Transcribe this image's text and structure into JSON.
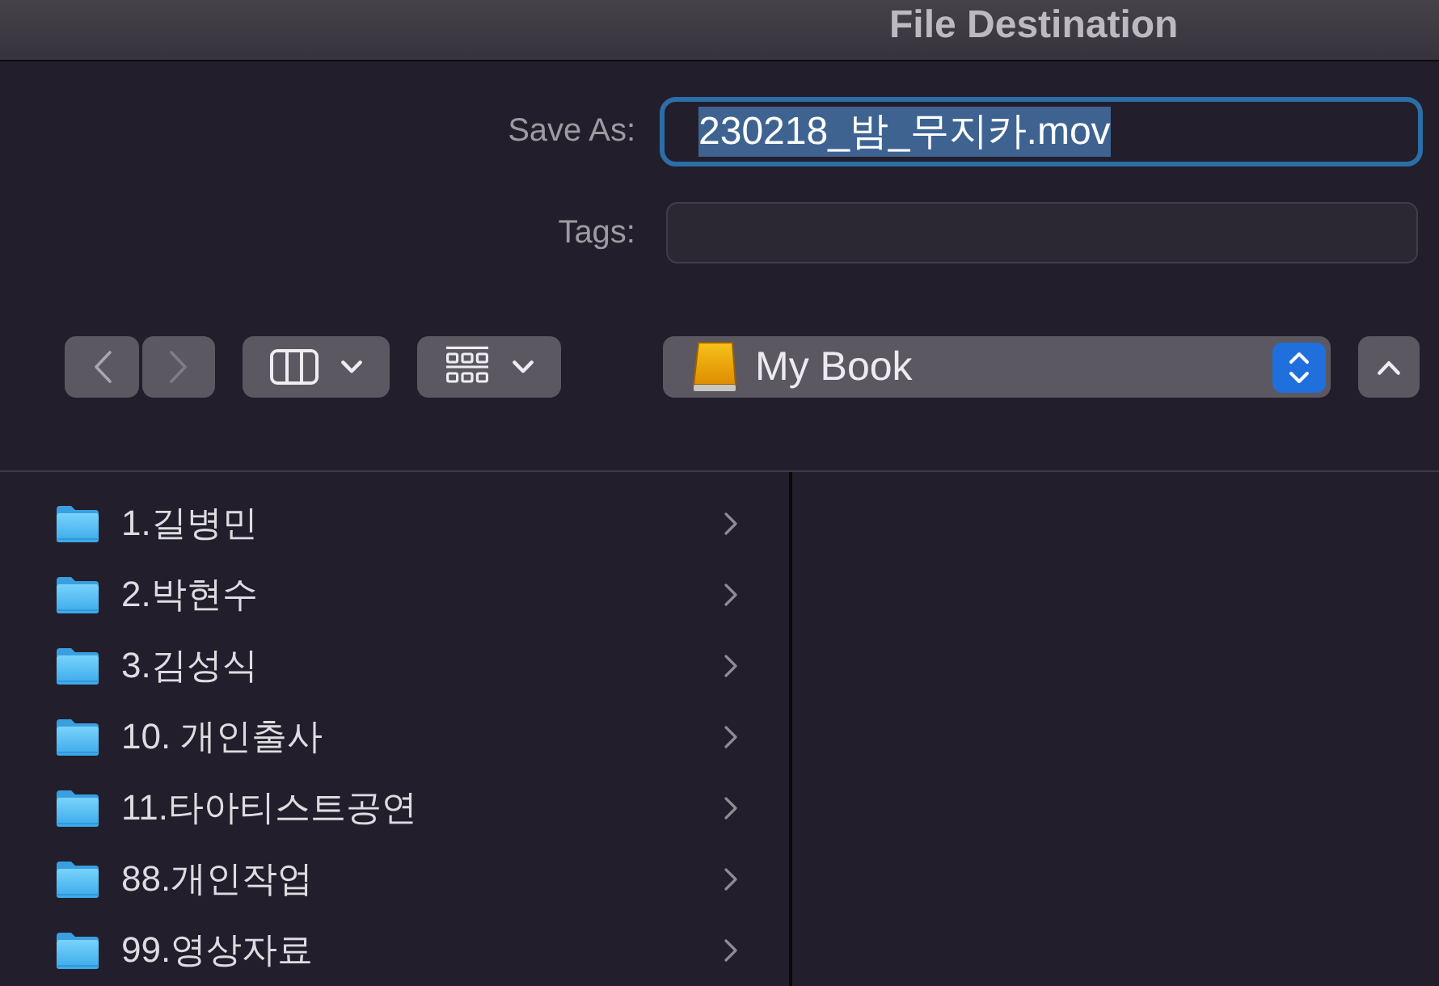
{
  "window": {
    "title": "File Destination"
  },
  "save_as": {
    "label": "Save As:",
    "value": "230218_밤_무지카.mov",
    "focused": true,
    "selected": true
  },
  "tags": {
    "label": "Tags:"
  },
  "toolbar": {
    "back": {
      "disabled": false
    },
    "forward": {
      "disabled": true
    },
    "location": {
      "label": "My Book"
    }
  },
  "browser": {
    "items": [
      {
        "name": "1.길병민",
        "kind": "folder",
        "selected": false
      },
      {
        "name": "2.박현수",
        "kind": "folder",
        "selected": false
      },
      {
        "name": "3.김성식",
        "kind": "folder",
        "selected": false
      },
      {
        "name": "10. 개인출사",
        "kind": "folder",
        "selected": false
      },
      {
        "name": "11.타아티스트공연",
        "kind": "folder",
        "selected": false
      },
      {
        "name": "88.개인작업",
        "kind": "folder",
        "selected": false
      },
      {
        "name": "99.영상자료",
        "kind": "folder",
        "selected": false
      }
    ]
  }
}
